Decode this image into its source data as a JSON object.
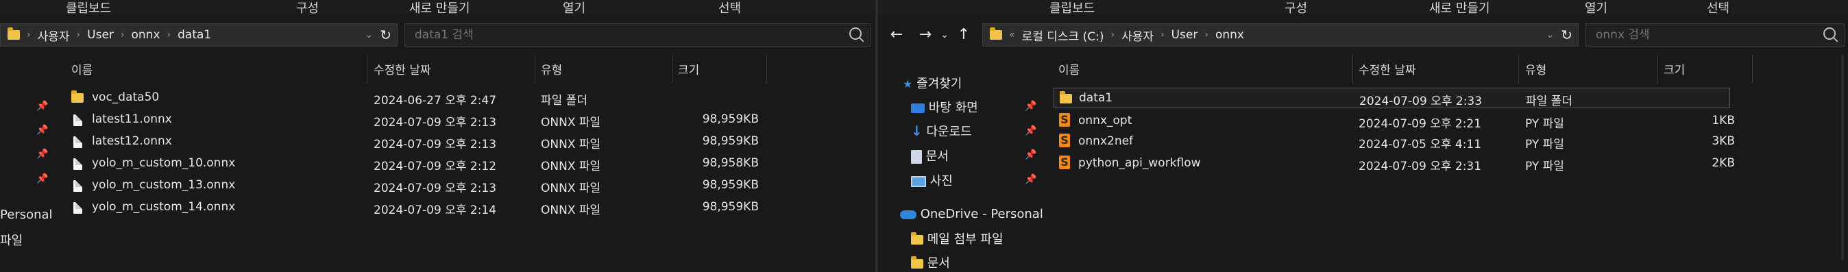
{
  "left": {
    "ribbon": [
      "클립보드",
      "구성",
      "새로 만들기",
      "열기",
      "선택"
    ],
    "breadcrumb": [
      "사용자",
      "User",
      "onnx",
      "data1"
    ],
    "search_placeholder": "data1 검색",
    "columns": [
      "이름",
      "수정한 날짜",
      "유형",
      "크기"
    ],
    "nav": [
      "Personal",
      "파일"
    ],
    "rows": [
      {
        "icon": "folder",
        "name": "voc_data50",
        "date": "2024-06-27 오후 2:47",
        "type": "파일 폴더",
        "size": ""
      },
      {
        "icon": "file",
        "name": "latest11.onnx",
        "date": "2024-07-09 오후 2:13",
        "type": "ONNX 파일",
        "size": "98,959KB"
      },
      {
        "icon": "file",
        "name": "latest12.onnx",
        "date": "2024-07-09 오후 2:13",
        "type": "ONNX 파일",
        "size": "98,959KB"
      },
      {
        "icon": "file",
        "name": "yolo_m_custom_10.onnx",
        "date": "2024-07-09 오후 2:12",
        "type": "ONNX 파일",
        "size": "98,958KB"
      },
      {
        "icon": "file",
        "name": "yolo_m_custom_13.onnx",
        "date": "2024-07-09 오후 2:13",
        "type": "ONNX 파일",
        "size": "98,959KB"
      },
      {
        "icon": "file",
        "name": "yolo_m_custom_14.onnx",
        "date": "2024-07-09 오후 2:14",
        "type": "ONNX 파일",
        "size": "98,959KB"
      }
    ]
  },
  "right": {
    "ribbon": [
      "클립보드",
      "구성",
      "새로 만들기",
      "열기",
      "선택"
    ],
    "breadcrumb": [
      "로컬 디스크 (C:)",
      "사용자",
      "User",
      "onnx"
    ],
    "search_placeholder": "onnx 검색",
    "columns": [
      "이름",
      "수정한 날짜",
      "유형",
      "크기"
    ],
    "nav": {
      "quick_access": "즐겨찾기",
      "items": [
        "바탕 화면",
        "다운로드",
        "문서",
        "사진"
      ],
      "onedrive": "OneDrive - Personal",
      "onedrive_items": [
        "메일 첨부 파일",
        "문서"
      ]
    },
    "rows": [
      {
        "icon": "folder",
        "name": "data1",
        "date": "2024-07-09 오후 2:33",
        "type": "파일 폴더",
        "size": ""
      },
      {
        "icon": "py",
        "name": "onnx_opt",
        "date": "2024-07-09 오후 2:21",
        "type": "PY 파일",
        "size": "1KB"
      },
      {
        "icon": "py",
        "name": "onnx2nef",
        "date": "2024-07-05 오후 4:11",
        "type": "PY 파일",
        "size": "3KB"
      },
      {
        "icon": "py",
        "name": "python_api_workflow",
        "date": "2024-07-09 오후 2:31",
        "type": "PY 파일",
        "size": "2KB"
      }
    ]
  },
  "colors": {
    "background": "#191919",
    "folder": "#f0c54a",
    "accent": "#3d8fe0",
    "python": "#f08a1c"
  }
}
